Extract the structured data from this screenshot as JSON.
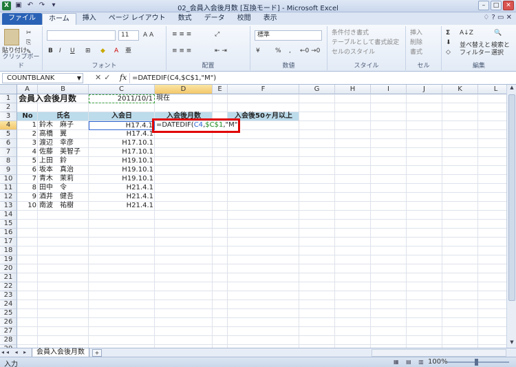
{
  "window": {
    "title": "02_会員入会後月数 [互換モード] - Microsoft Excel"
  },
  "ribbon_tabs": [
    "ファイル",
    "ホーム",
    "挿入",
    "ページ レイアウト",
    "数式",
    "データ",
    "校閲",
    "表示"
  ],
  "ribbon": {
    "clipboard": {
      "paste": "貼り付け",
      "label": "クリップボード"
    },
    "font": {
      "size": "11",
      "label": "フォント"
    },
    "alignment": {
      "label": "配置"
    },
    "number": {
      "format": "標準",
      "label": "数値"
    },
    "styles": {
      "conditional": "条件付き書式",
      "table": "テーブルとして書式設定",
      "cell": "セルのスタイル",
      "label": "スタイル"
    },
    "cells": {
      "insert": "挿入",
      "delete": "削除",
      "format": "書式",
      "label": "セル"
    },
    "editing": {
      "sort": "並べ替えと",
      "filter": "フィルター",
      "find": "検索と",
      "select": "選択",
      "label": "編集"
    }
  },
  "formula_bar": {
    "name_box": "COUNTBLANK",
    "formula": "=DATEDIF(C4,$C$1,\"M\")"
  },
  "columns": [
    "A",
    "B",
    "C",
    "D",
    "E",
    "F",
    "G",
    "H",
    "I",
    "J",
    "K",
    "L"
  ],
  "rows": [
    "1",
    "2",
    "3",
    "4",
    "5",
    "6",
    "7",
    "8",
    "9",
    "10",
    "11",
    "12",
    "13",
    "14",
    "15",
    "16",
    "17",
    "18",
    "19",
    "20",
    "21",
    "22",
    "23",
    "24",
    "25",
    "26",
    "27",
    "28",
    "29"
  ],
  "sheet": {
    "title": "会員入会後月数",
    "date": "2011/10/1",
    "date_suffix": "現在",
    "headers": {
      "no": "No",
      "name": "氏名",
      "join": "入会日",
      "months": "入会後月数",
      "over50": "入会後50ヶ月以上"
    },
    "editing_formula": {
      "prefix": "=DATEDIF(",
      "ref1": "C4",
      "sep": ",",
      "ref2": "$C$1",
      "suffix": ",\"M\")"
    },
    "members": [
      {
        "no": "1",
        "name": "鈴木　麻子",
        "date": "H17.4.1"
      },
      {
        "no": "2",
        "name": "高橋　翼",
        "date": "H17.4.1"
      },
      {
        "no": "3",
        "name": "渡辺　幸彦",
        "date": "H17.10.1"
      },
      {
        "no": "4",
        "name": "佐藤　美智子",
        "date": "H17.10.1"
      },
      {
        "no": "5",
        "name": "上田　鈴",
        "date": "H19.10.1"
      },
      {
        "no": "6",
        "name": "坂本　真治",
        "date": "H19.10.1"
      },
      {
        "no": "7",
        "name": "青木　茉莉",
        "date": "H19.10.1"
      },
      {
        "no": "8",
        "name": "田中　令",
        "date": "H21.4.1"
      },
      {
        "no": "9",
        "name": "酒井　健吾",
        "date": "H21.4.1"
      },
      {
        "no": "10",
        "name": "南波　祐樹",
        "date": "H21.4.1"
      }
    ]
  },
  "sheet_tab": "会員入会後月数",
  "status": {
    "mode": "入力",
    "zoom": "100%"
  }
}
